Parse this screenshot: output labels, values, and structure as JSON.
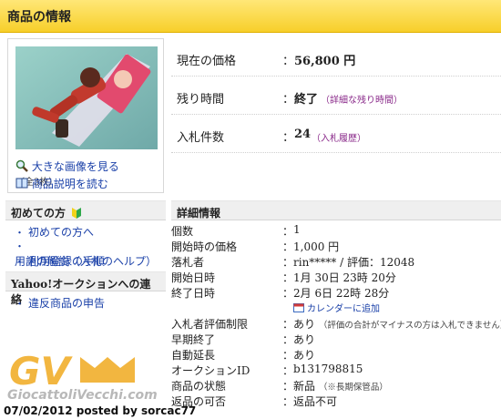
{
  "header": {
    "title": "商品の情報"
  },
  "image_panel": {
    "large_image_link": "大きな画像を見る",
    "large_image_count": "（全3枚）",
    "description_link": "商品説明を読む"
  },
  "summary": {
    "price": {
      "label": "現在の価格",
      "value": "56,800 円"
    },
    "time_left": {
      "label": "残り時間",
      "value": "終了",
      "detail_link": "（詳細な残り時間）"
    },
    "bids": {
      "label": "入札件数",
      "value": "24",
      "history_link": "（入札履歴）"
    }
  },
  "sidebar": {
    "beginners": {
      "title": "初めての方",
      "items": [
        "初めての方へ",
        "用語の解説（入札のヘルプ）",
        "利用登録の手順"
      ]
    },
    "contact": {
      "title": "Yahoo!オークションへの連絡",
      "items": [
        "違反商品の申告"
      ]
    }
  },
  "details": {
    "title": "詳細情報",
    "rows": [
      {
        "label": "個数",
        "value": "1"
      },
      {
        "label": "開始時の価格",
        "value": "1,000 円"
      },
      {
        "label": "落札者",
        "value": "rin***** / 評価：12048"
      },
      {
        "label": "開始日時",
        "value": "1月 30日 23時 20分"
      },
      {
        "label": "終了日時",
        "value": "2月 6日 22時 28分"
      },
      {
        "label": "",
        "value": "",
        "calendar_link": "カレンダーに追加"
      },
      {
        "label": "入札者評価制限",
        "value": "あり",
        "note": "（評価の合計がマイナスの方は入札できません）"
      },
      {
        "label": "早期終了",
        "value": "あり"
      },
      {
        "label": "自動延長",
        "value": "あり"
      },
      {
        "label": "オークションID",
        "value": "b131798815"
      },
      {
        "label": "商品の状態",
        "value": "新品",
        "note": "（※長期保管品）"
      },
      {
        "label": "返品の可否",
        "value": "返品不可"
      }
    ]
  },
  "watermark": {
    "logo_text": "GV",
    "site": "GiocattoliVecchi.com",
    "posted": "07/02/2012 posted by sorcac77"
  },
  "colors": {
    "header_top": "#ffe777",
    "header_bottom": "#f7cf2a",
    "link": "#1a40a8",
    "sub_link": "#8a2a8a",
    "section_bg": "#efefef",
    "logo": "#f2b640"
  },
  "icons": [
    "magnifier-icon",
    "book-icon",
    "beginner-leaf-icon",
    "calendar-icon"
  ]
}
